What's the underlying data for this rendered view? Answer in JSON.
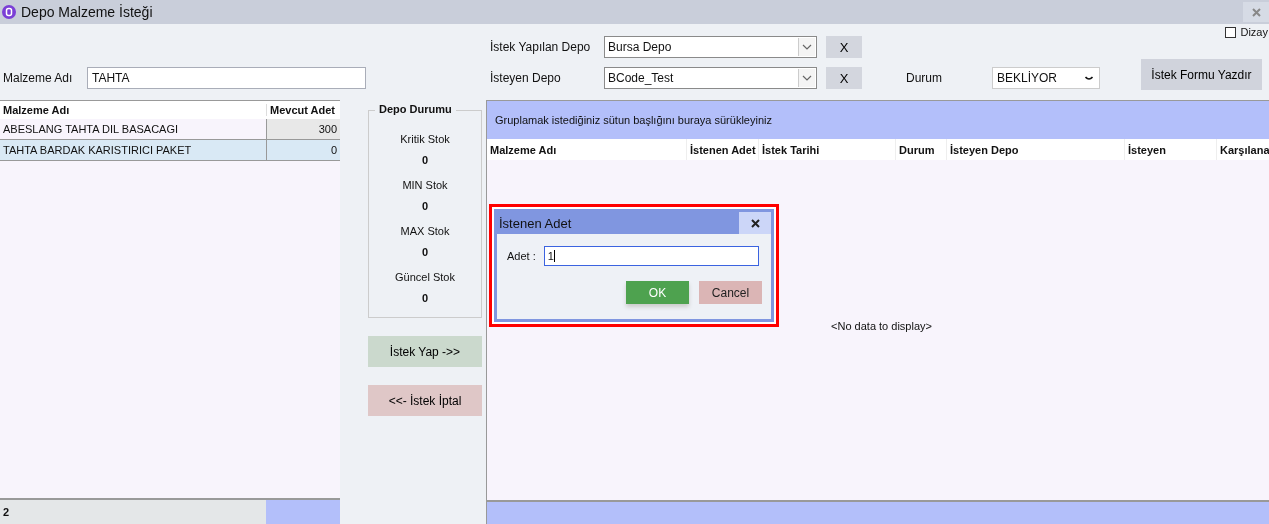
{
  "window": {
    "title": "Depo Malzeme İsteği"
  },
  "design_checkbox": {
    "label": "Dizay",
    "checked": false
  },
  "filter": {
    "label": "Malzeme Adı",
    "value": "TAHTA"
  },
  "depots": [
    {
      "label": "İstek Yapılan Depo",
      "value": "Bursa Depo",
      "clear": "X"
    },
    {
      "label": "İsteyen Depo",
      "value": "BCode_Test",
      "clear": "X"
    }
  ],
  "status": {
    "label": "Durum",
    "value": "BEKLİYOR"
  },
  "print_button": "İstek Formu Yazdır",
  "materials": {
    "columns": [
      "Malzeme Adı",
      "Mevcut Adet"
    ],
    "rows": [
      {
        "name": "ABESLANG TAHTA DIL BASACAGI",
        "qty": "300",
        "selected": false
      },
      {
        "name": "TAHTA BARDAK KARISTIRICI PAKET",
        "qty": "0",
        "selected": true
      }
    ],
    "count": "2"
  },
  "depo_status": {
    "title": "Depo Durumu",
    "items": [
      {
        "label": "Kritik Stok",
        "value": "0"
      },
      {
        "label": "MIN Stok",
        "value": "0"
      },
      {
        "label": "MAX Stok",
        "value": "0"
      },
      {
        "label": "Güncel Stok",
        "value": "0"
      }
    ]
  },
  "actions": [
    {
      "label": "İstek Yap ->>",
      "kind": "add"
    },
    {
      "label": "<<- İstek İptal",
      "kind": "remove"
    }
  ],
  "requests": {
    "group_hint": "Gruplamak istediğiniz sütun başlığını buraya sürükleyiniz",
    "columns": [
      "Malzeme Adı",
      "İstenen Adet",
      "İstek Tarihi",
      "Durum",
      "İsteyen Depo",
      "İsteyen",
      "Karşılana"
    ],
    "empty": "<No data to display>"
  },
  "dialog": {
    "title": "İstenen Adet",
    "field_label": "Adet :",
    "value": "1",
    "buttons": [
      {
        "label": "OK",
        "kind": "ok"
      },
      {
        "label": "Cancel",
        "kind": "cancel"
      }
    ]
  }
}
